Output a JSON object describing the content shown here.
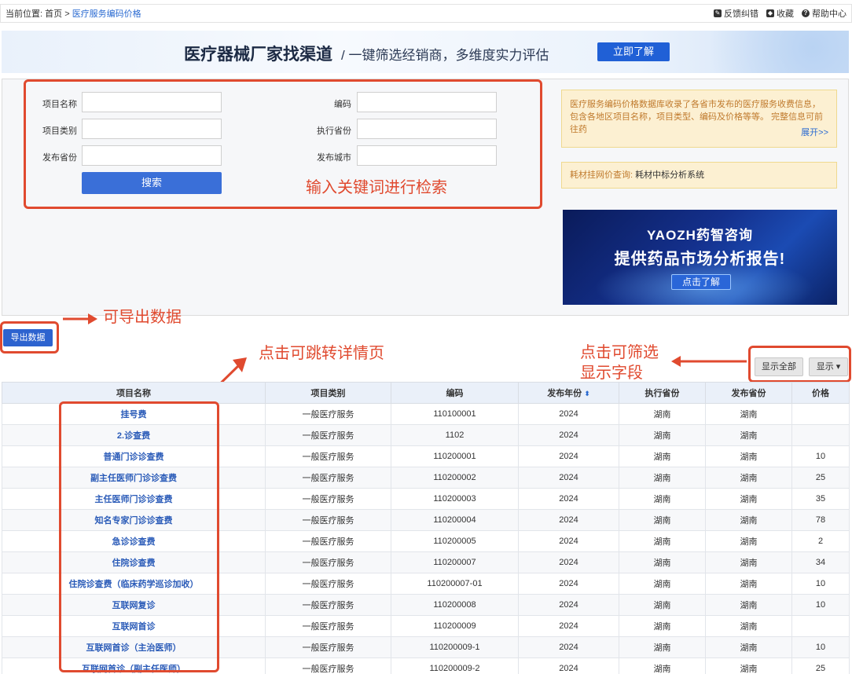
{
  "breadcrumb": {
    "prefix": "当前位置:",
    "home": "首页",
    "sep": ">",
    "current": "医疗服务编码价格"
  },
  "tools": {
    "feedback": "反馈纠错",
    "favorite": "收藏",
    "help": "帮助中心"
  },
  "banner": {
    "title": "医疗器械厂家找渠道",
    "subtitle": "/ 一键筛选经销商，多维度实力评估",
    "button": "立即了解"
  },
  "form": {
    "name_label": "项目名称",
    "code_label": "编码",
    "category_label": "项目类别",
    "exec_province_label": "执行省份",
    "pub_province_label": "发布省份",
    "pub_city_label": "发布城市",
    "search_button": "搜索"
  },
  "notices": {
    "info_text": "医疗服务编码价格数据库收录了各省市发布的医疗服务收费信息，包含各地区项目名称，项目类型、编码及价格等等。 完整信息可前往药",
    "info_more": "展开>>",
    "link_key": "耗材挂网价查询:",
    "link_value": "耗材中标分析系统"
  },
  "ad": {
    "brand": "YAOZH药智咨询",
    "slogan": "提供药品市场分析报告!",
    "button": "点击了解"
  },
  "actions": {
    "export": "导出数据",
    "show_all": "显示全部",
    "show": "显示 ▾"
  },
  "annotations": {
    "search": "输入关键词进行检索",
    "export": "可导出数据",
    "detail": "点击可跳转详情页",
    "filter_line1": "点击可筛选",
    "filter_line2": "显示字段"
  },
  "table": {
    "headers": [
      "项目名称",
      "项目类别",
      "编码",
      "发布年份",
      "执行省份",
      "发布省份",
      "价格"
    ],
    "sort_icon": "⬍",
    "rows": [
      [
        "挂号费",
        "一般医疗服务",
        "110100001",
        "2024",
        "湖南",
        "湖南",
        ""
      ],
      [
        "2.诊查费",
        "一般医疗服务",
        "1102",
        "2024",
        "湖南",
        "湖南",
        ""
      ],
      [
        "普通门诊诊查费",
        "一般医疗服务",
        "110200001",
        "2024",
        "湖南",
        "湖南",
        "10"
      ],
      [
        "副主任医师门诊诊查费",
        "一般医疗服务",
        "110200002",
        "2024",
        "湖南",
        "湖南",
        "25"
      ],
      [
        "主任医师门诊诊查费",
        "一般医疗服务",
        "110200003",
        "2024",
        "湖南",
        "湖南",
        "35"
      ],
      [
        "知名专家门诊诊查费",
        "一般医疗服务",
        "110200004",
        "2024",
        "湖南",
        "湖南",
        "78"
      ],
      [
        "急诊诊查费",
        "一般医疗服务",
        "110200005",
        "2024",
        "湖南",
        "湖南",
        "2"
      ],
      [
        "住院诊查费",
        "一般医疗服务",
        "110200007",
        "2024",
        "湖南",
        "湖南",
        "34"
      ],
      [
        "住院诊查费（临床药学巡诊加收）",
        "一般医疗服务",
        "110200007-01",
        "2024",
        "湖南",
        "湖南",
        "10"
      ],
      [
        "互联网复诊",
        "一般医疗服务",
        "110200008",
        "2024",
        "湖南",
        "湖南",
        "10"
      ],
      [
        "互联网首诊",
        "一般医疗服务",
        "110200009",
        "2024",
        "湖南",
        "湖南",
        ""
      ],
      [
        "互联网首诊（主治医师）",
        "一般医疗服务",
        "110200009-1",
        "2024",
        "湖南",
        "湖南",
        "10"
      ],
      [
        "互联网首诊（副主任医师）",
        "一般医疗服务",
        "110200009-2",
        "2024",
        "湖南",
        "湖南",
        "25"
      ]
    ]
  },
  "colors": {
    "accent": "#2d63cf",
    "annotation": "#e04a2f",
    "link": "#2a5bb8"
  }
}
